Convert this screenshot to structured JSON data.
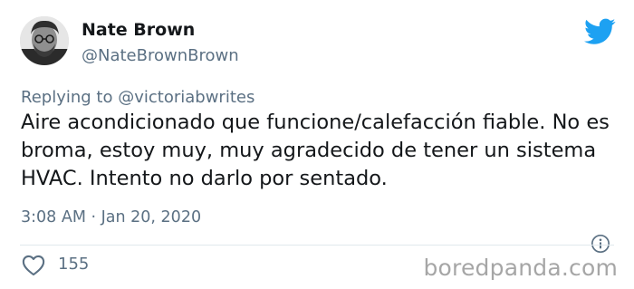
{
  "author": {
    "display_name": "Nate Brown",
    "handle": "@NateBrownBrown"
  },
  "reply": {
    "prefix": "Replying to",
    "target": "@victoriabwrites"
  },
  "tweet": {
    "text": "Aire acondicionado que funcione/calefacción fiable. No es broma, estoy muy, muy agradecido de tener un sistema HVAC. Intento no darlo por sentado."
  },
  "meta": {
    "timestamp": "3:08 AM · Jan 20, 2020"
  },
  "actions": {
    "like_count": "155"
  },
  "watermark": "boredpanda.com",
  "icons": {
    "brand": "twitter-bird-icon",
    "info": "info-icon",
    "like": "heart-icon"
  },
  "colors": {
    "twitter_blue": "#1da1f2",
    "secondary_text": "#5b7083",
    "primary_text": "#14171a"
  }
}
